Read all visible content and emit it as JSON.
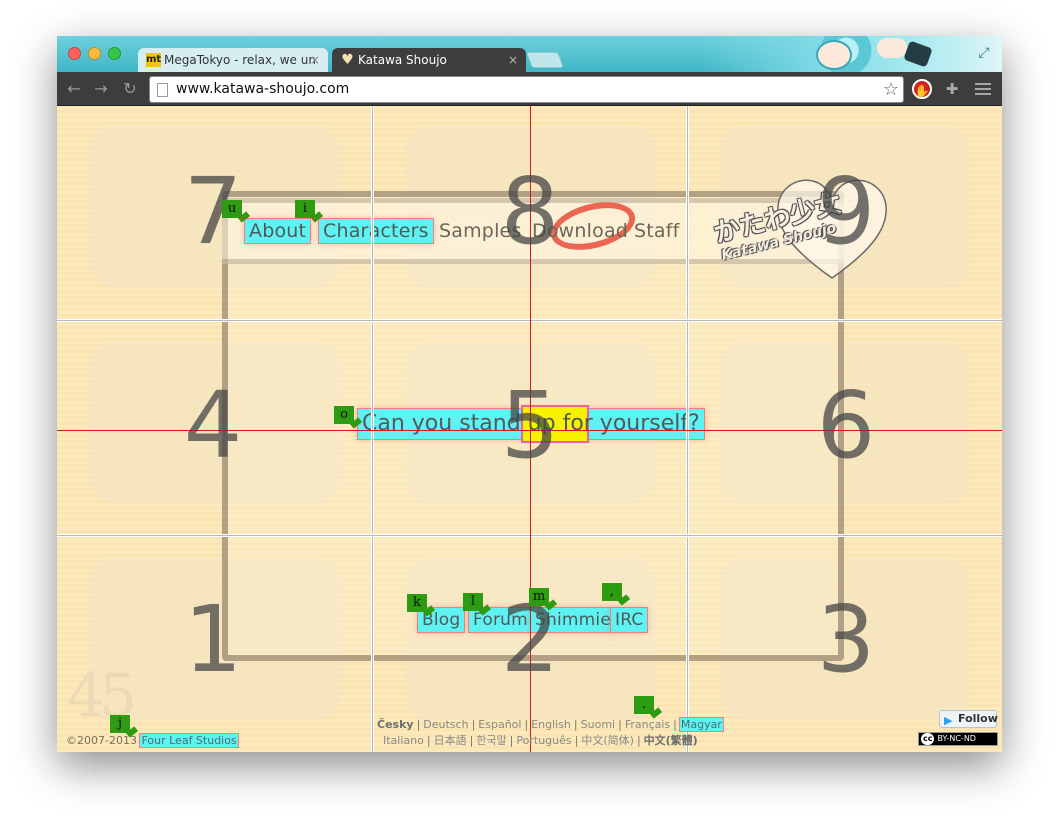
{
  "browser": {
    "tabs": [
      {
        "title": "MegaTokyo - relax, we un",
        "favicon": "mt",
        "active": false
      },
      {
        "title": "Katawa Shoujo",
        "favicon": "heart-icon",
        "active": true
      }
    ],
    "url": "www.katawa-shoujo.com",
    "tab_close_glyph": "×"
  },
  "logo": {
    "japanese": "かたわ少女",
    "english": "Katawa Shoujo"
  },
  "nav": {
    "about": "About",
    "characters": "Characters",
    "samples": "Samples",
    "download": "Download",
    "staff": "Staff"
  },
  "tagline": "Can you stand up for yourself?",
  "footer_links": {
    "blog": "Blog",
    "forum": "Forum",
    "shimmie": "Shimmie",
    "irc": "IRC"
  },
  "grid_numbers": [
    "7",
    "8",
    "9",
    "4",
    "5",
    "6",
    "1",
    "2",
    "3"
  ],
  "hints": {
    "about": "u",
    "characters": "i",
    "tagline": "o",
    "blog": "k",
    "forum": "l",
    "shimmie": "m",
    "irc": ",",
    "magyar": ".",
    "four_leaf": "j"
  },
  "footer": {
    "copyright": "©2007-2013",
    "studio": "Four Leaf Studios",
    "languages_row1": [
      "Česky",
      "Deutsch",
      "Español",
      "English",
      "Suomi",
      "Français",
      "Magyar"
    ],
    "languages_row2": [
      "Italiano",
      "日本語",
      "한국말",
      "Português",
      "中文(简体)",
      "中文(繁體)"
    ],
    "follow": "Follow",
    "license": "BY-NC-ND",
    "license_mark": "cc"
  },
  "colors": {
    "hint_bg": "#2e9c13",
    "highlight": "#5ff2f2",
    "accent_red": "#d21a1a",
    "page_bg": "#fce8b6"
  }
}
